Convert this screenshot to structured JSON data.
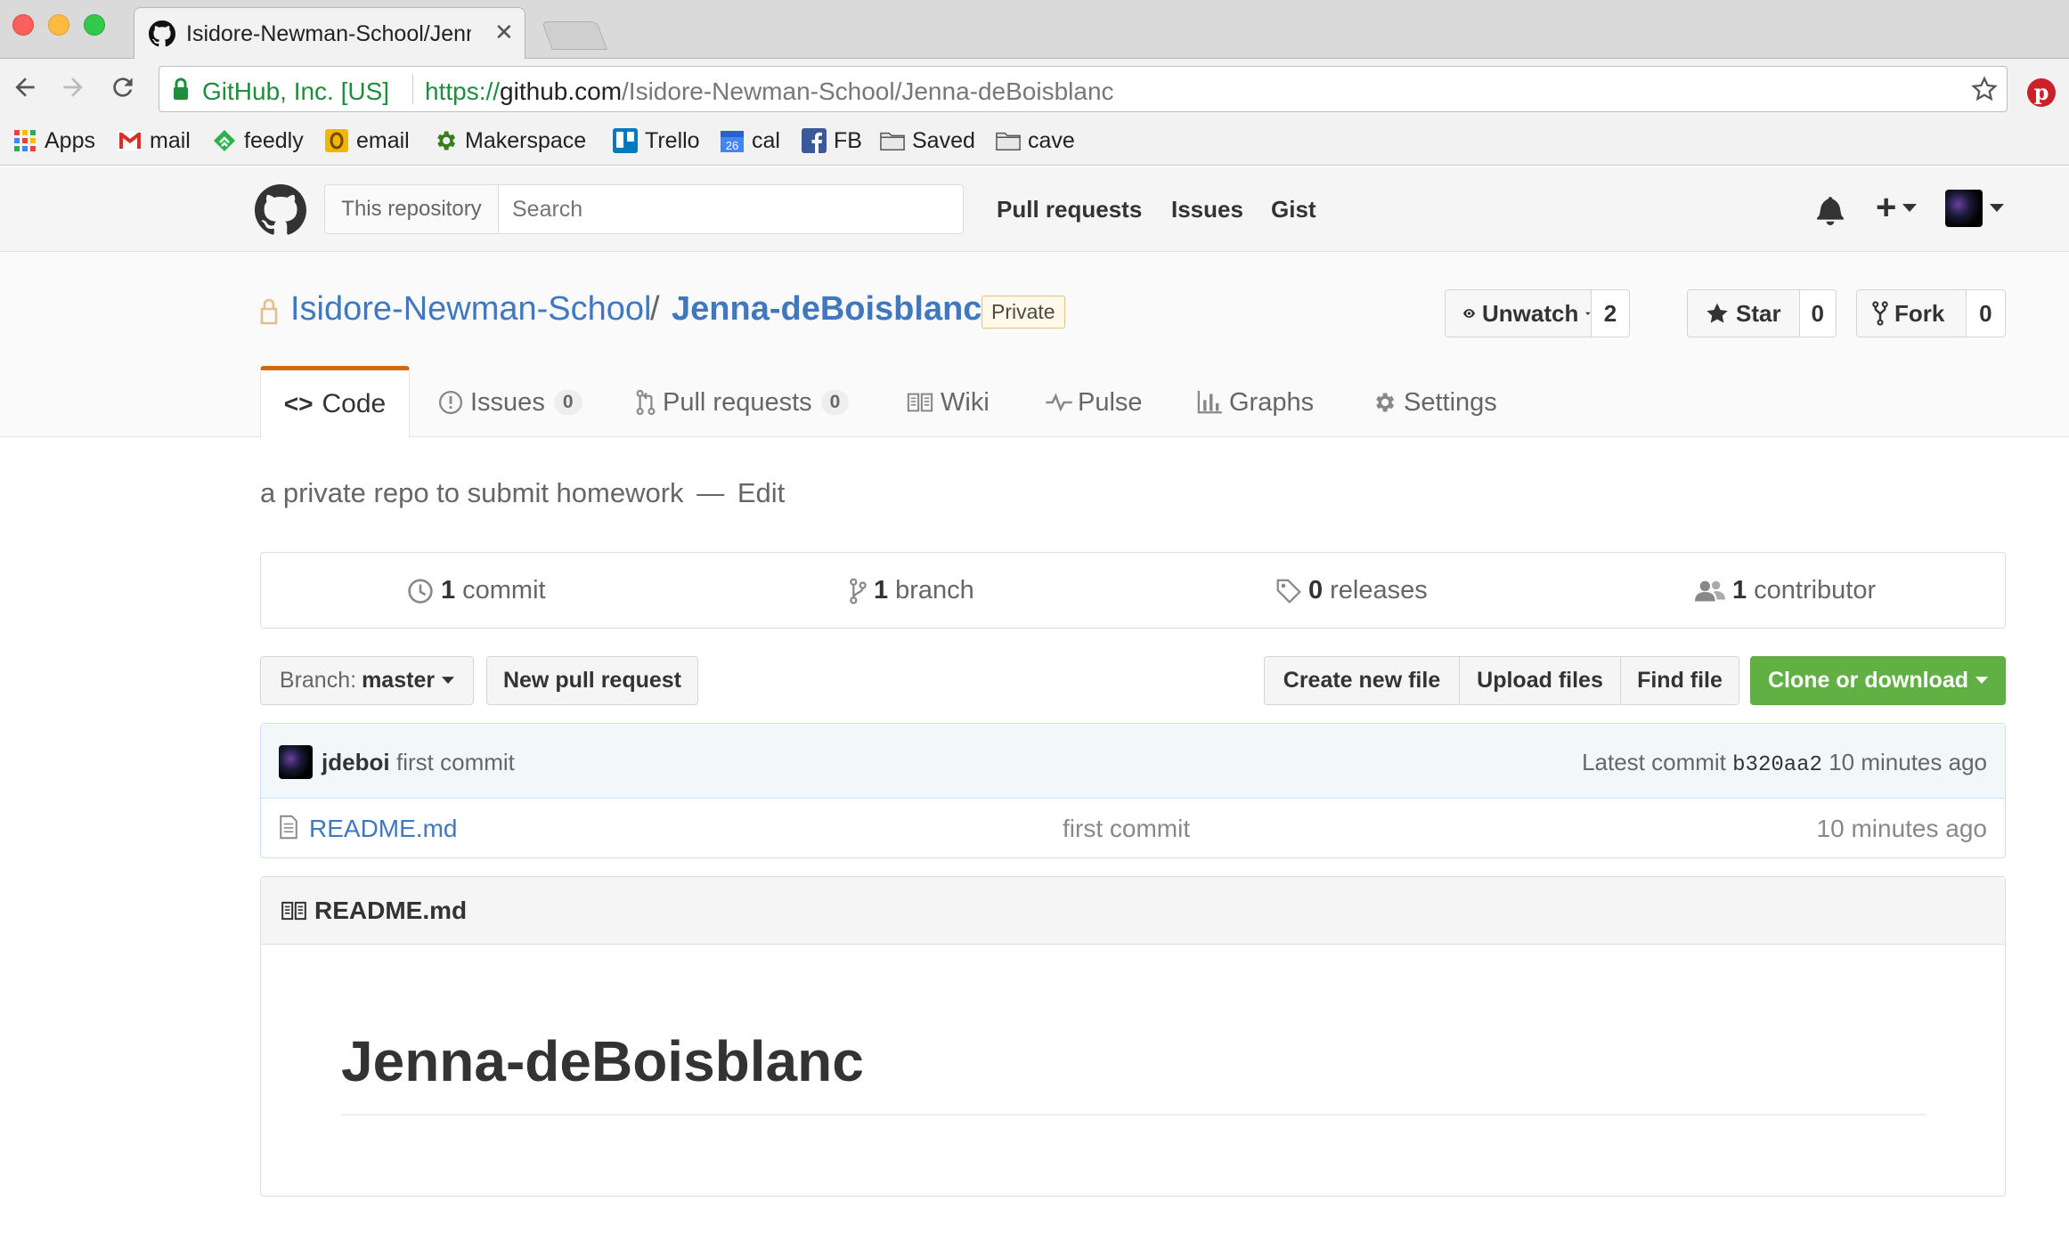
{
  "browser": {
    "tab_title": "Isidore-Newman-School/Jenna",
    "url_secure_label": "GitHub, Inc. [US]",
    "url_scheme": "https://",
    "url_host": "github.com",
    "url_path": "/Isidore-Newman-School/Jenna-deBoisblanc",
    "bookmarks": [
      "Apps",
      "mail",
      "feedly",
      "email",
      "Makerspace",
      "Trello",
      "cal",
      "FB",
      "Saved",
      "cave"
    ],
    "cal_day": "26"
  },
  "gh_header": {
    "scope_label": "This repository",
    "search_placeholder": "Search",
    "nav": [
      "Pull requests",
      "Issues",
      "Gist"
    ]
  },
  "repo": {
    "owner": "Isidore-Newman-School",
    "separator": "/",
    "name": "Jenna-deBoisblanc",
    "visibility_badge": "Private",
    "unwatch_label": "Unwatch",
    "watch_count": "2",
    "star_label": "Star",
    "star_count": "0",
    "fork_label": "Fork",
    "fork_count": "0"
  },
  "tabs": {
    "code": "Code",
    "issues": "Issues",
    "issues_count": "0",
    "pulls": "Pull requests",
    "pulls_count": "0",
    "wiki": "Wiki",
    "pulse": "Pulse",
    "graphs": "Graphs",
    "settings": "Settings"
  },
  "description": {
    "text": "a private repo to submit homework",
    "dash": "—",
    "edit": "Edit"
  },
  "summary": {
    "commits_num": "1",
    "commits_label": "commit",
    "branches_num": "1",
    "branches_label": "branch",
    "releases_num": "0",
    "releases_label": "releases",
    "contributors_num": "1",
    "contributors_label": "contributor"
  },
  "file_nav": {
    "branch_prefix": "Branch:",
    "branch_name": "master",
    "new_pr": "New pull request",
    "create_file": "Create new file",
    "upload_files": "Upload files",
    "find_file": "Find file",
    "clone": "Clone or download"
  },
  "commit": {
    "author": "jdeboi",
    "message": "first commit",
    "latest_label": "Latest commit",
    "sha": "b320aa2",
    "time": "10 minutes ago"
  },
  "files": [
    {
      "name": "README.md",
      "message": "first commit",
      "age": "10 minutes ago"
    }
  ],
  "readme": {
    "filename": "README.md",
    "heading": "Jenna-deBoisblanc"
  },
  "colors": {
    "link": "#4078c0",
    "clone_green": "#6cc644",
    "tab_accent": "#d26911",
    "secure_green": "#1e8e3e"
  }
}
